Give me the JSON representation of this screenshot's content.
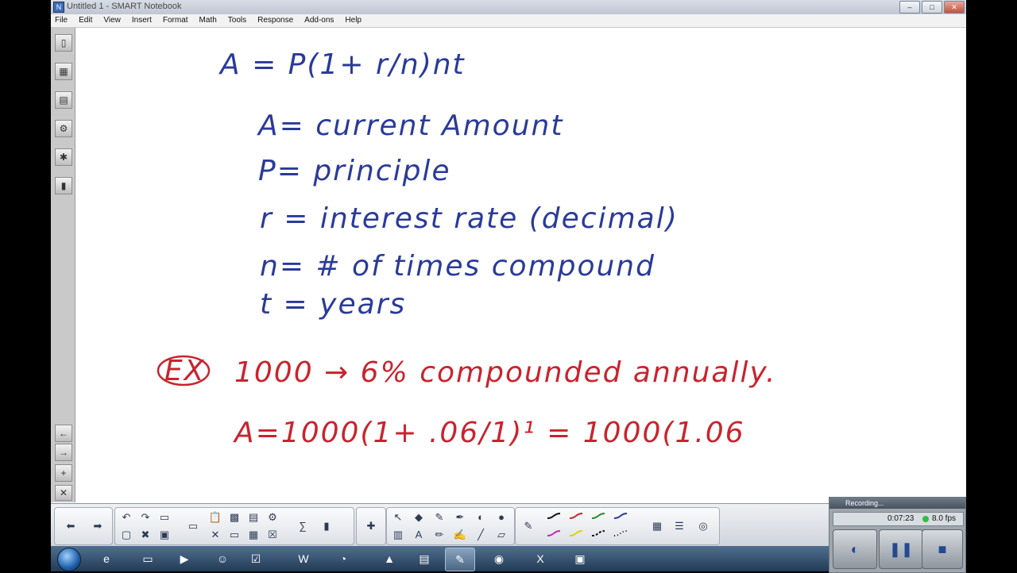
{
  "window": {
    "title": "Untitled 1 - SMART Notebook",
    "controls": [
      "–",
      "□",
      "✕"
    ]
  },
  "menubar": {
    "items": [
      "File",
      "Edit",
      "View",
      "Insert",
      "Format",
      "Math",
      "Tools",
      "Response",
      "Add-ons",
      "Help"
    ]
  },
  "canvas": {
    "formula": "A = P(1+ r/n)nt",
    "definitions": [
      "A= current Amount",
      "P= principle",
      "r = interest rate (decimal)",
      "n= # of times compound",
      "t = years"
    ],
    "example_label": "EX",
    "example_text": "1000 → 6% compounded annually.",
    "example_work": "A=1000(1+ .06/1)¹ = 1000(1.06"
  },
  "recorder": {
    "title": "Recording...",
    "elapsed": "0:07:23",
    "fps": "8.0 fps"
  },
  "colors": {
    "ink_blue": "#2a3a9a",
    "ink_red": "#c8242e",
    "recording_indicator": "#2fbf3f"
  }
}
